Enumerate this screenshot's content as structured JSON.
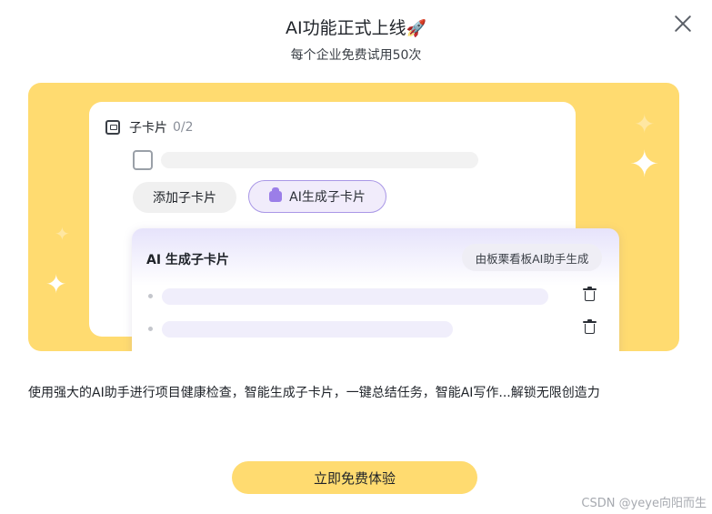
{
  "header": {
    "title": "AI功能正式上线",
    "title_emoji": "🚀",
    "subtitle": "每个企业免费试用50次"
  },
  "icons": {
    "close": "close-icon",
    "card": "card-icon",
    "ai": "ai-magic-icon",
    "trash": "trash-icon",
    "sparkle": "sparkle-icon"
  },
  "preview": {
    "card": {
      "label": "子卡片",
      "count": "0/2",
      "add_button": "添加子卡片",
      "ai_button": "AI生成子卡片"
    },
    "panel": {
      "title": "AI 生成子卡片",
      "tag": "由板栗看板AI助手生成"
    }
  },
  "description": "使用强大的AI助手进行项目健康检查，智能生成子卡片，一键总结任务，智能AI写作...解锁无限创造力",
  "cta_label": "立即免费体验",
  "watermark": "CSDN @yeye向阳而生",
  "colors": {
    "banner": "#ffdb70",
    "cta": "#ffdb70",
    "accent_purple": "#a997e6"
  }
}
